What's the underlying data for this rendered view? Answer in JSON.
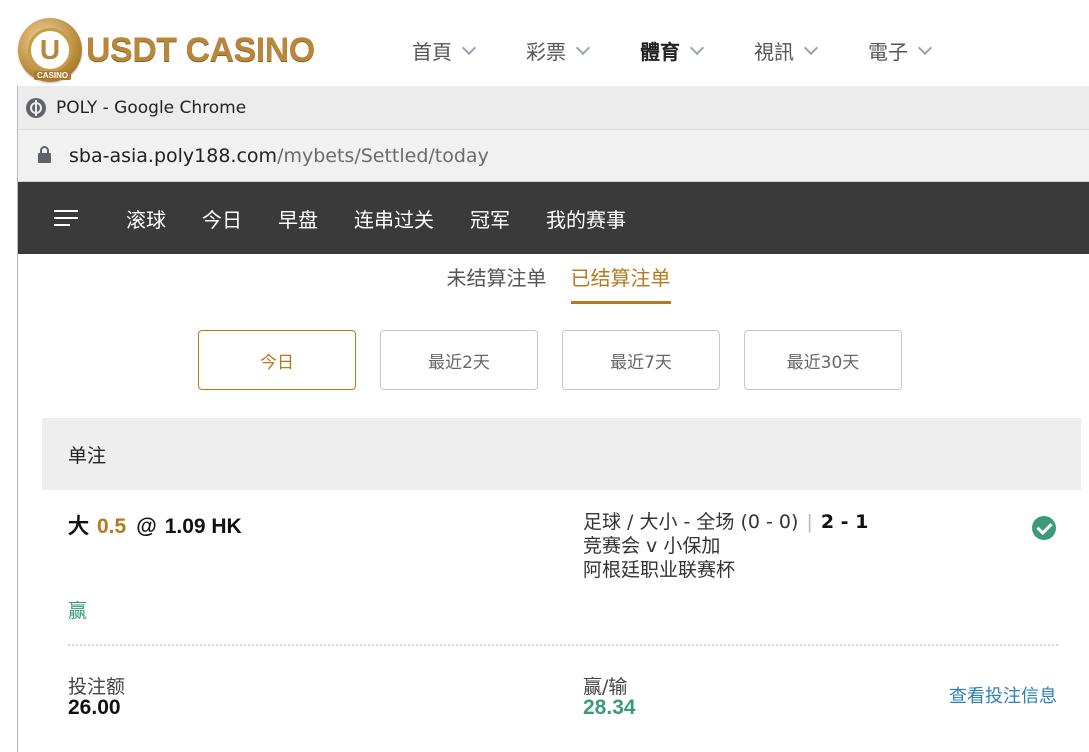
{
  "casino": {
    "logo_text": "USDT CASINO",
    "logo_letter": "U",
    "logo_sub": "CASINO",
    "nav": [
      {
        "label": "首頁",
        "active": false
      },
      {
        "label": "彩票",
        "active": false
      },
      {
        "label": "體育",
        "active": true
      },
      {
        "label": "視訊",
        "active": false
      },
      {
        "label": "電子",
        "active": false
      }
    ]
  },
  "browser": {
    "window_title": "POLY - Google Chrome",
    "url_host": "sba-asia.poly188.com",
    "url_path": "/mybets/Settled/today"
  },
  "sport_nav": {
    "tabs": [
      "滚球",
      "今日",
      "早盘",
      "连串过关",
      "冠军",
      "我的赛事"
    ]
  },
  "bets_page": {
    "subtabs": [
      {
        "label": "未结算注单",
        "active": false
      },
      {
        "label": "已结算注单",
        "active": true
      }
    ],
    "filters": [
      {
        "label": "今日",
        "active": true
      },
      {
        "label": "最近2天",
        "active": false
      },
      {
        "label": "最近7天",
        "active": false
      },
      {
        "label": "最近30天",
        "active": false
      }
    ],
    "section_title": "单注",
    "bet": {
      "selection": "大",
      "line": "0.5",
      "at": "@",
      "odds": "1.09 HK",
      "market": "足球 / 大小 - 全场 (0 - 0)",
      "separator": "|",
      "score": "2 - 1",
      "match": "竞赛会 v 小保加",
      "league": "阿根廷职业联赛杯",
      "result": "赢",
      "stake_label": "投注额",
      "stake_value": "26.00",
      "winloss_label": "赢/输",
      "winloss_value": "28.34",
      "detail_link": "查看投注信息"
    }
  },
  "colors": {
    "accent": "#b7791f",
    "win": "#3a9a7a",
    "link": "#2c7fb8",
    "nav_bg": "#3a3a3a"
  }
}
